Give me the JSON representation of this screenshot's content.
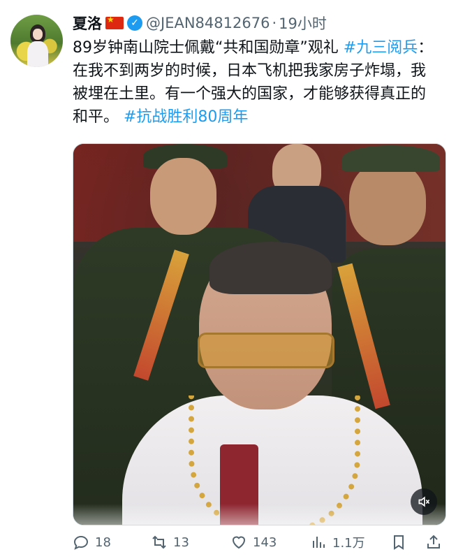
{
  "tweet": {
    "author": {
      "display_name": "夏洛",
      "flag_icon": "china-flag-icon",
      "verified_icon": "verified-badge-icon",
      "handle": "@JEAN84812676",
      "separator": "·",
      "time": "19小时"
    },
    "text": {
      "part1": "89岁钟南山院士佩戴“共和国勋章”观礼 ",
      "hashtag1": "#九三阅兵",
      "part2": "：在我不到两岁的时候，日本飞机把我家房子炸塌，我被埋在土里。有一个强大的国家，才能够获得真正的和平。 ",
      "hashtag2": "#抗战胜利80周年"
    },
    "media": {
      "mute_icon": "speaker-muted-icon"
    },
    "actions": {
      "replies": "18",
      "retweets": "13",
      "likes": "143",
      "views": "1.1万"
    }
  },
  "colors": {
    "accent": "#1d9bf0",
    "secondary_text": "#536471",
    "primary_text": "#0f1419"
  }
}
